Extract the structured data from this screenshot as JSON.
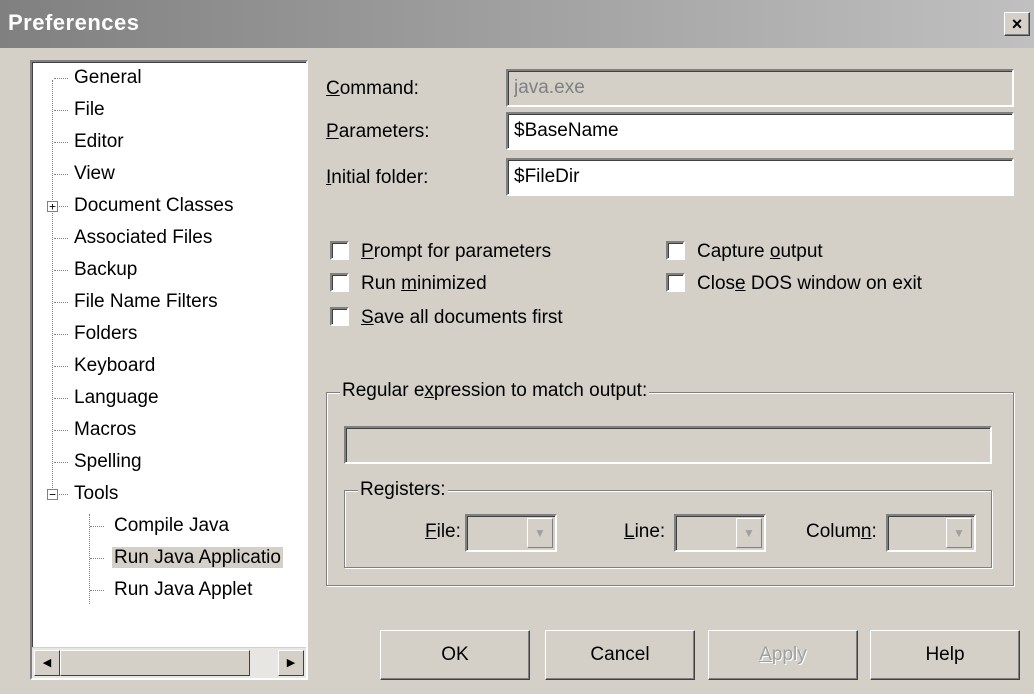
{
  "window": {
    "title": "Preferences",
    "close_glyph": "×"
  },
  "tree": {
    "items": [
      {
        "label": "General"
      },
      {
        "label": "File"
      },
      {
        "label": "Editor"
      },
      {
        "label": "View"
      },
      {
        "label": "Document Classes",
        "expander": "+"
      },
      {
        "label": "Associated Files"
      },
      {
        "label": "Backup"
      },
      {
        "label": "File Name Filters"
      },
      {
        "label": "Folders"
      },
      {
        "label": "Keyboard"
      },
      {
        "label": "Language"
      },
      {
        "label": "Macros"
      },
      {
        "label": "Spelling"
      },
      {
        "label": "Tools",
        "expander": "−"
      },
      {
        "label": "Compile Java"
      },
      {
        "label": "Run Java Applicatio",
        "selected": true
      },
      {
        "label": "Run Java Applet"
      }
    ],
    "scroll_left_glyph": "◀",
    "scroll_right_glyph": "▶"
  },
  "form": {
    "command": {
      "label_u": "C",
      "label_rest": "ommand:",
      "value": "java.exe"
    },
    "parameters": {
      "label_u": "P",
      "label_rest": "arameters:",
      "value": "$BaseName"
    },
    "initial_folder": {
      "label_u": "I",
      "label_rest": "nitial folder:",
      "value": "$FileDir"
    }
  },
  "checkboxes": {
    "prompt": {
      "u": "P",
      "rest": "rompt for parameters",
      "checked": false
    },
    "run_min": {
      "pre": "Run ",
      "u": "m",
      "rest": "inimized",
      "checked": false
    },
    "save_all": {
      "u": "S",
      "rest": "ave all documents first",
      "checked": false
    },
    "capture": {
      "pre": "Capture ",
      "u": "o",
      "rest": "utput",
      "checked": false
    },
    "close_dos": {
      "pre": "Clos",
      "u": "e",
      "rest": " DOS window on exit",
      "checked": false
    }
  },
  "regex_group": {
    "title_pre": "Regular e",
    "title_u": "x",
    "title_rest": "pression to match output:",
    "value": ""
  },
  "registers": {
    "title": "Registers:",
    "file": {
      "u": "F",
      "rest": "ile:"
    },
    "line": {
      "u": "L",
      "rest": "ine:"
    },
    "column": {
      "pre": "Colum",
      "u": "n",
      "rest": ":"
    },
    "arrow_glyph": "▼"
  },
  "buttons": {
    "ok": "OK",
    "cancel": "Cancel",
    "apply_u": "A",
    "apply_rest": "pply",
    "help": "Help"
  }
}
